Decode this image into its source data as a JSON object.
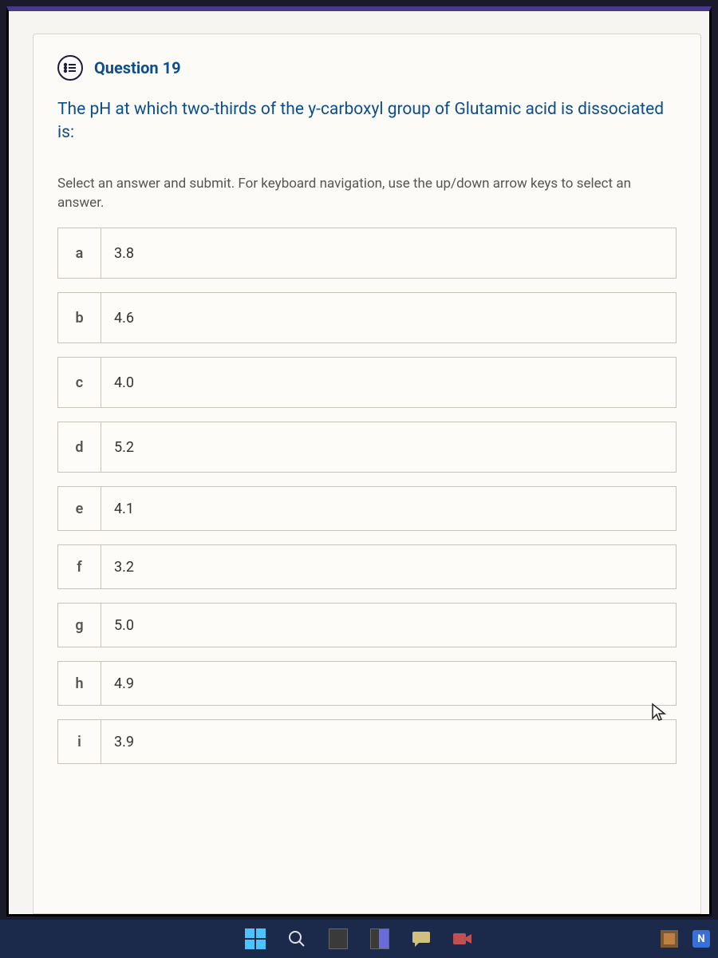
{
  "question": {
    "label": "Question 19",
    "text": "The pH at which two-thirds of the y-carboxyl group of Glutamic acid is dissociated is:",
    "instructions": "Select an answer and submit. For keyboard navigation, use the up/down arrow keys to select an answer."
  },
  "options": [
    {
      "letter": "a",
      "value": "3.8"
    },
    {
      "letter": "b",
      "value": "4.6"
    },
    {
      "letter": "c",
      "value": "4.0"
    },
    {
      "letter": "d",
      "value": "5.2"
    },
    {
      "letter": "e",
      "value": "4.1"
    },
    {
      "letter": "f",
      "value": "3.2"
    },
    {
      "letter": "g",
      "value": "5.0"
    },
    {
      "letter": "h",
      "value": "4.9"
    },
    {
      "letter": "i",
      "value": "3.9"
    }
  ],
  "taskbar": {
    "notifications_badge": "N"
  }
}
